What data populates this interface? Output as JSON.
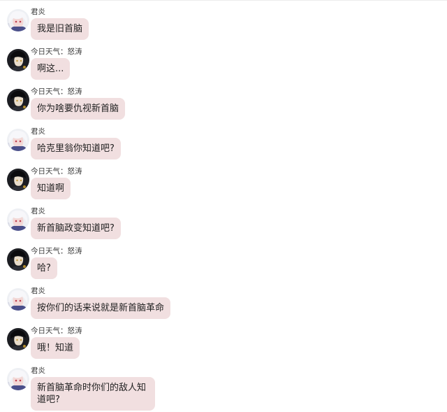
{
  "users": {
    "a": {
      "name": "君炎",
      "avatar_icon": "white-hair-anime-avatar-icon"
    },
    "b": {
      "name": "今日天气：怒涛",
      "avatar_icon": "dark-hair-anime-avatar-icon"
    }
  },
  "messages": [
    {
      "sender": "君炎",
      "text": "我是旧首脑"
    },
    {
      "sender": "今日天气：怒涛",
      "text": "啊这..."
    },
    {
      "sender": "今日天气：怒涛",
      "text": "你为啥要仇视新首脑"
    },
    {
      "sender": "君炎",
      "text": "哈克里翁你知道吧?"
    },
    {
      "sender": "今日天气：怒涛",
      "text": "知道啊"
    },
    {
      "sender": "君炎",
      "text": "新首脑政变知道吧?"
    },
    {
      "sender": "今日天气：怒涛",
      "text": "哈?"
    },
    {
      "sender": "君炎",
      "text": "按你们的话来说就是新首脑革命"
    },
    {
      "sender": "今日天气：怒涛",
      "text": "哦！知道"
    },
    {
      "sender": "君炎",
      "text": "新首脑革命时你们的敌人知道吧?"
    }
  ],
  "colors": {
    "bubble": "#f1dfe0",
    "text": "#222222",
    "sender": "#3a3a3a"
  }
}
